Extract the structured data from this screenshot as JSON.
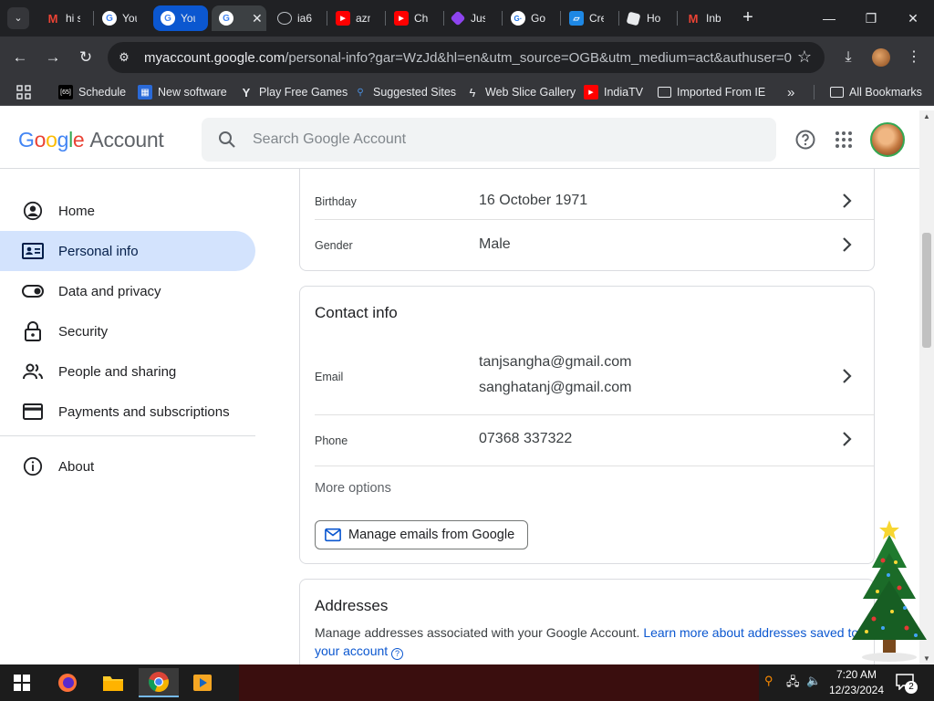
{
  "browser": {
    "tabs": [
      {
        "title": "hi s",
        "icon": "gmail-icon"
      },
      {
        "title": "You",
        "icon": "google-icon"
      },
      {
        "title": "You",
        "icon": "google-icon"
      },
      {
        "title": "",
        "icon": "google-icon"
      },
      {
        "title": "ia6",
        "icon": "globe-icon"
      },
      {
        "title": "azn",
        "icon": "youtube-icon"
      },
      {
        "title": "Ch",
        "icon": "youtube-icon"
      },
      {
        "title": "Jus",
        "icon": "app-icon"
      },
      {
        "title": "Go",
        "icon": "google-lens-icon"
      },
      {
        "title": "Cre",
        "icon": "app-icon"
      },
      {
        "title": "Ho",
        "icon": "roblox-icon"
      },
      {
        "title": "Inb",
        "icon": "gmail-icon"
      }
    ],
    "url_host": "myaccount.google.com",
    "url_path": "/personal-info?gar=WzJd&hl=en&utm_source=OGB&utm_medium=act&authuser=0",
    "bookmarks": [
      {
        "label": "Schedule"
      },
      {
        "label": "New software"
      },
      {
        "label": "Play Free Games"
      },
      {
        "label": "Suggested Sites"
      },
      {
        "label": "Web Slice Gallery"
      },
      {
        "label": "IndiaTV"
      },
      {
        "label": "Imported From IE"
      }
    ],
    "more_bookmarks": "»",
    "all_bookmarks": "All Bookmarks"
  },
  "header": {
    "logo_google": "Google",
    "logo_account": "Account",
    "search_placeholder": "Search Google Account"
  },
  "nav": {
    "items": [
      {
        "label": "Home"
      },
      {
        "label": "Personal info"
      },
      {
        "label": "Data and privacy"
      },
      {
        "label": "Security"
      },
      {
        "label": "People and sharing"
      },
      {
        "label": "Payments and subscriptions"
      },
      {
        "label": "About"
      }
    ]
  },
  "basic_info": {
    "birthday_label": "Birthday",
    "birthday_value": "16 October 1971",
    "gender_label": "Gender",
    "gender_value": "Male"
  },
  "contact": {
    "title": "Contact info",
    "email_label": "Email",
    "emails": [
      "tanjsangha@gmail.com",
      "sanghatanj@gmail.com"
    ],
    "phone_label": "Phone",
    "phone_value": "07368 337322",
    "more_options": "More options",
    "manage_button": "Manage emails from Google"
  },
  "addresses": {
    "title": "Addresses",
    "description": "Manage addresses associated with your Google Account.",
    "link": "Learn more about addresses saved to your account"
  },
  "taskbar": {
    "time": "7:20 AM",
    "date": "12/23/2024",
    "notifications": "2"
  },
  "colors": {
    "accent": "#0b57d0",
    "nav_active_bg": "#d3e3fd",
    "chrome_dark": "#35363a"
  }
}
